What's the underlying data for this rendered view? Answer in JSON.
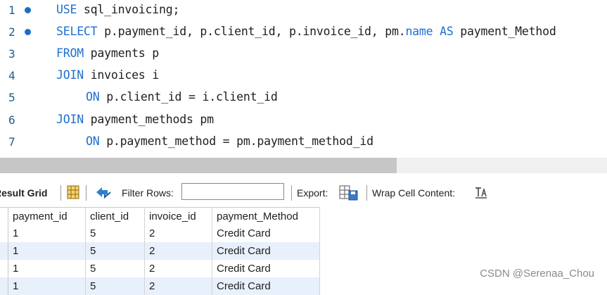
{
  "editor": {
    "lines": [
      {
        "num": "1",
        "breakpoint": true,
        "indent": 0,
        "tokens": [
          {
            "t": "USE",
            "kw": true
          },
          {
            "t": " sql_invoicing;",
            "kw": false
          }
        ]
      },
      {
        "num": "2",
        "breakpoint": true,
        "indent": 0,
        "tokens": [
          {
            "t": "SELECT",
            "kw": true
          },
          {
            "t": " p.payment_id, p.client_id, p.invoice_id, pm.",
            "kw": false
          },
          {
            "t": "name",
            "kw": true
          },
          {
            "t": " ",
            "kw": false
          },
          {
            "t": "AS",
            "kw": true
          },
          {
            "t": " payment_Method",
            "kw": false
          }
        ]
      },
      {
        "num": "3",
        "breakpoint": false,
        "indent": 0,
        "tokens": [
          {
            "t": "FROM",
            "kw": true
          },
          {
            "t": " payments p",
            "kw": false
          }
        ]
      },
      {
        "num": "4",
        "breakpoint": false,
        "indent": 0,
        "tokens": [
          {
            "t": "JOIN",
            "kw": true
          },
          {
            "t": " invoices i",
            "kw": false
          }
        ]
      },
      {
        "num": "5",
        "breakpoint": false,
        "indent": 1,
        "tokens": [
          {
            "t": "ON",
            "kw": true
          },
          {
            "t": " p.client_id = i.client_id",
            "kw": false
          }
        ]
      },
      {
        "num": "6",
        "breakpoint": false,
        "indent": 0,
        "tokens": [
          {
            "t": "JOIN",
            "kw": true
          },
          {
            "t": " payment_methods pm",
            "kw": false
          }
        ]
      },
      {
        "num": "7",
        "breakpoint": false,
        "indent": 1,
        "tokens": [
          {
            "t": "ON",
            "kw": true
          },
          {
            "t": " p.payment_method = pm.payment_method_id",
            "kw": false
          }
        ]
      }
    ]
  },
  "toolbar": {
    "result_grid_label": "Result Grid",
    "filter_rows_label": "Filter Rows:",
    "filter_value": "",
    "export_label": "Export:",
    "wrap_label": "Wrap Cell Content:"
  },
  "grid": {
    "columns": [
      "payment_id",
      "client_id",
      "invoice_id",
      "payment_Method"
    ],
    "rows": [
      [
        "1",
        "5",
        "2",
        "Credit Card"
      ],
      [
        "1",
        "5",
        "2",
        "Credit Card"
      ],
      [
        "1",
        "5",
        "2",
        "Credit Card"
      ],
      [
        "1",
        "5",
        "2",
        "Credit Card"
      ]
    ]
  },
  "watermark": "CSDN @Serenaa_Chou"
}
